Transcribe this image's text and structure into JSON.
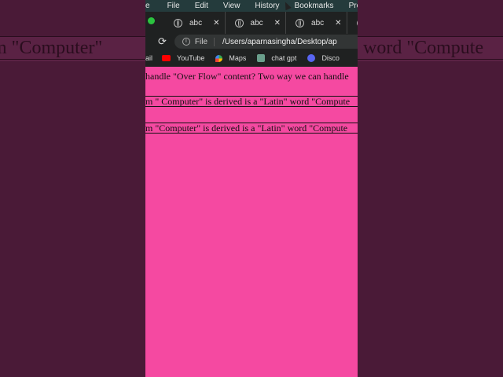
{
  "background": {
    "left_text": "m \"Computer\"",
    "right_text": "word \"Compute"
  },
  "menubar": {
    "items": [
      "e",
      "File",
      "Edit",
      "View",
      "History",
      "Bookmarks",
      "Pro"
    ]
  },
  "tabs": [
    {
      "label": "abc",
      "close": "✕"
    },
    {
      "label": "abc",
      "close": "✕"
    },
    {
      "label": "abc",
      "close": "✕"
    },
    {
      "label": "a"
    }
  ],
  "toolbar": {
    "reload_icon": "⟳",
    "info_icon": "i",
    "file_label": "File",
    "url": "/Users/aparnasingha/Desktop/ap"
  },
  "bookmarks": {
    "items": [
      "ail",
      "YouTube",
      "Maps",
      "chat gpt",
      "Disco"
    ]
  },
  "page": {
    "line1": "handle \"Over Flow\" content? Two way we can handle",
    "box1": "m \" Computer\" is derived is a \"Latin\" word \"Compute",
    "box2": "m \"Computer\" is derived is a \"Latin\" word \"Compute"
  },
  "colors": {
    "page_bg": "#f549a1",
    "letterbox": "#4a1a37",
    "browser_chrome": "#1f2121",
    "menubar": "#243b3c"
  }
}
